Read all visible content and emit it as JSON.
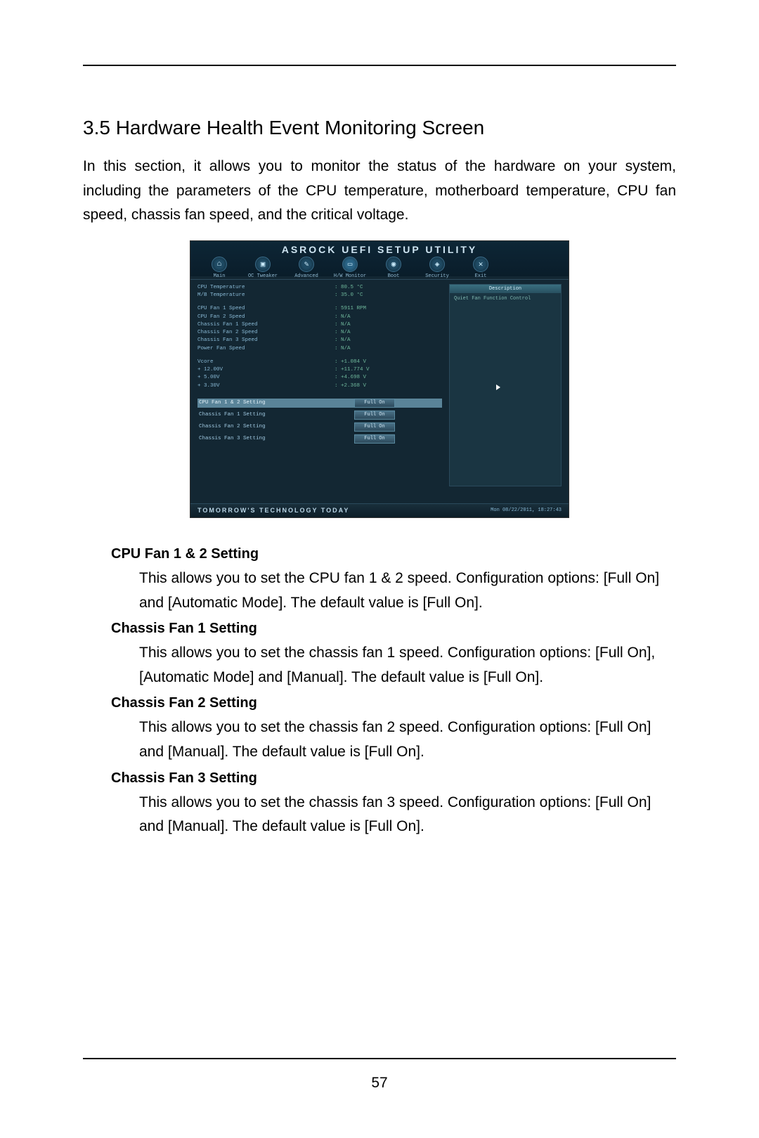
{
  "section": {
    "heading": "3.5  Hardware Health Event Monitoring Screen",
    "intro": "In this section, it allows you to monitor the status of the hardware on your system, including the parameters of the CPU temperature, motherboard temperature, CPU fan speed, chassis fan speed, and the critical voltage."
  },
  "bios": {
    "title": "ASROCK UEFI SETUP UTILITY",
    "tabs": [
      {
        "label": "Main",
        "glyph": "⌂"
      },
      {
        "label": "OC Tweaker",
        "glyph": "▣"
      },
      {
        "label": "Advanced",
        "glyph": "✎"
      },
      {
        "label": "H/W Monitor",
        "glyph": "▭"
      },
      {
        "label": "Boot",
        "glyph": "◉"
      },
      {
        "label": "Security",
        "glyph": "◈"
      },
      {
        "label": "Exit",
        "glyph": "✕"
      }
    ],
    "readings_temp": [
      {
        "k": "CPU Temperature",
        "v": ": 80.5 °C"
      },
      {
        "k": "M/B Temperature",
        "v": ": 35.0 °C"
      }
    ],
    "readings_fan": [
      {
        "k": "CPU Fan 1 Speed",
        "v": ": 5911 RPM"
      },
      {
        "k": "CPU Fan 2 Speed",
        "v": ": N/A"
      },
      {
        "k": "Chassis Fan 1 Speed",
        "v": ": N/A"
      },
      {
        "k": "Chassis Fan 2 Speed",
        "v": ": N/A"
      },
      {
        "k": "Chassis Fan 3 Speed",
        "v": ": N/A"
      },
      {
        "k": "Power Fan Speed",
        "v": ": N/A"
      }
    ],
    "readings_volt": [
      {
        "k": "Vcore",
        "v": ": +1.084 V"
      },
      {
        "k": "+ 12.00V",
        "v": ": +11.774 V"
      },
      {
        "k": "+ 5.00V",
        "v": ": +4.698 V"
      },
      {
        "k": "+ 3.30V",
        "v": ": +2.368 V"
      }
    ],
    "settings": [
      {
        "k": "CPU Fan 1 & 2 Setting",
        "v": "Full On",
        "highlight": true
      },
      {
        "k": "Chassis Fan 1 Setting",
        "v": "Full On",
        "highlight": false
      },
      {
        "k": "Chassis Fan 2 Setting",
        "v": "Full On",
        "highlight": false
      },
      {
        "k": "Chassis Fan 3 Setting",
        "v": "Full On",
        "highlight": false
      }
    ],
    "help_title": "Description",
    "help_text": "Quiet Fan Function Control",
    "slogan": "TOMORROW'S TECHNOLOGY TODAY",
    "datetime": "Mon 08/22/2011, 18:27:43"
  },
  "descriptions": [
    {
      "term": "CPU Fan 1 & 2 Setting",
      "text": "This allows you to set the CPU fan 1 & 2 speed. Configuration options: [Full On] and [Automatic Mode]. The default value is [Full On]."
    },
    {
      "term": "Chassis Fan 1 Setting",
      "text": "This allows you to set the chassis fan 1 speed. Configuration options: [Full On], [Automatic Mode] and [Manual]. The default value is [Full On]."
    },
    {
      "term": "Chassis Fan 2 Setting",
      "text": "This allows you to set the chassis fan 2 speed. Configuration options: [Full On] and [Manual]. The default value is [Full On]."
    },
    {
      "term": "Chassis Fan 3 Setting",
      "text": "This allows you to set the chassis fan 3 speed. Configuration options: [Full On] and [Manual]. The default value is [Full On]."
    }
  ],
  "page_number": "57"
}
